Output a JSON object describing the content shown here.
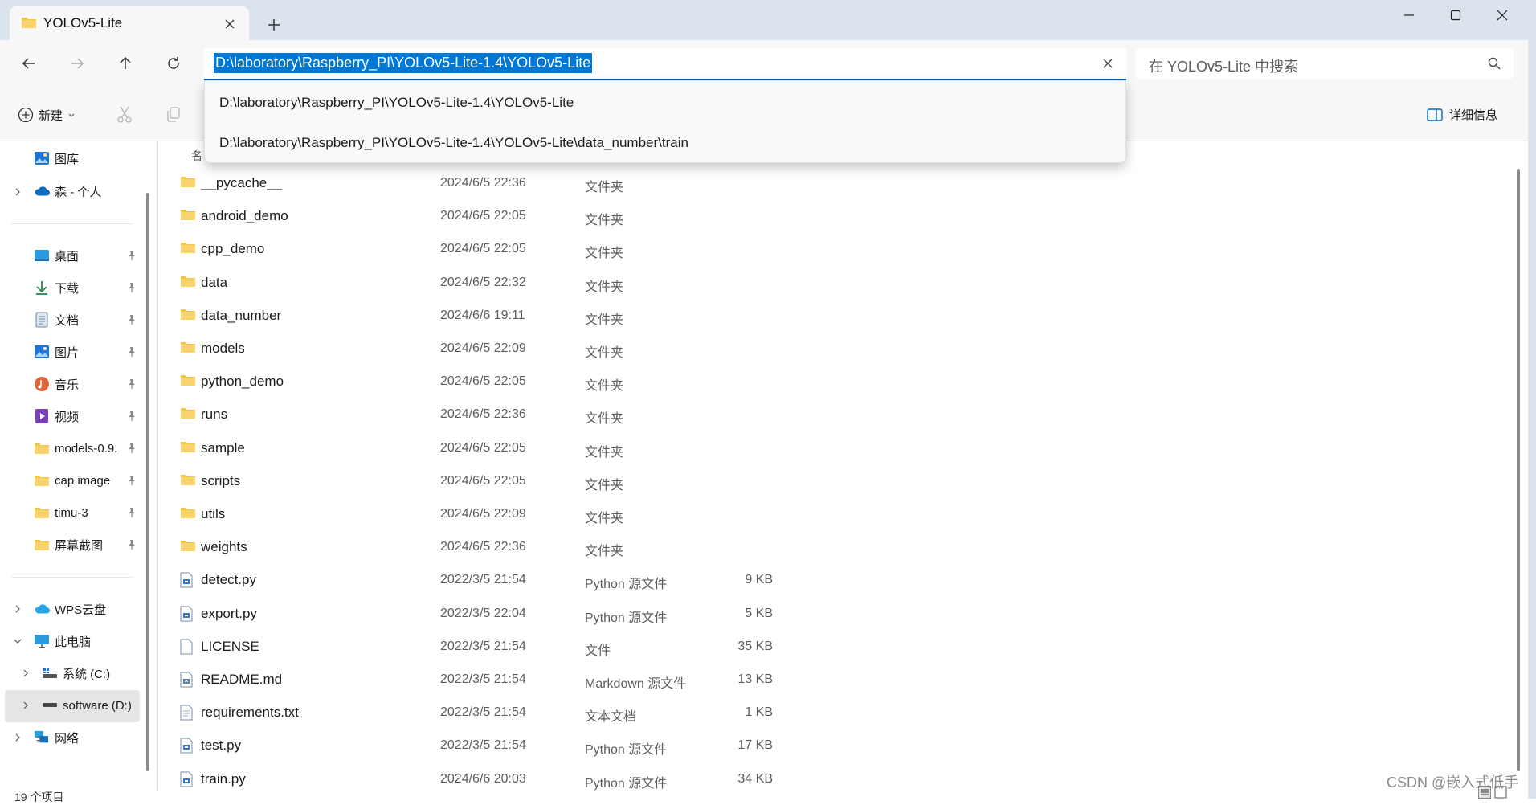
{
  "window": {
    "tab_title": "YOLOv5-Lite",
    "new_tab_label": "+",
    "controls": {
      "minimize": "minimize-icon",
      "maximize": "maximize-icon",
      "close": "close-icon"
    }
  },
  "nav": {
    "address_value": "D:\\laboratory\\Raspberry_PI\\YOLOv5-Lite-1.4\\YOLOv5-Lite",
    "search_placeholder": "在 YOLOv5-Lite 中搜索",
    "suggestions": [
      "D:\\laboratory\\Raspberry_PI\\YOLOv5-Lite-1.4\\YOLOv5-Lite",
      "D:\\laboratory\\Raspberry_PI\\YOLOv5-Lite-1.4\\YOLOv5-Lite\\data_number\\train"
    ]
  },
  "commandbar": {
    "new_label": "新建",
    "details_label": "详细信息"
  },
  "sidebar": {
    "gallery": "图库",
    "onedrive": "森 - 个人",
    "quick_access": [
      {
        "label": "桌面",
        "icon": "desktop-icon"
      },
      {
        "label": "下载",
        "icon": "download-icon"
      },
      {
        "label": "文档",
        "icon": "document-icon"
      },
      {
        "label": "图片",
        "icon": "pictures-icon"
      },
      {
        "label": "音乐",
        "icon": "music-icon"
      },
      {
        "label": "视频",
        "icon": "video-icon"
      },
      {
        "label": "models-0.9.",
        "icon": "folder-icon"
      },
      {
        "label": "cap image",
        "icon": "folder-icon"
      },
      {
        "label": "timu-3",
        "icon": "folder-icon"
      },
      {
        "label": "屏幕截图",
        "icon": "folder-icon"
      }
    ],
    "wps": "WPS云盘",
    "this_pc": "此电脑",
    "drive_c": "系统 (C:)",
    "drive_d": "software (D:)",
    "network": "网络",
    "status_count": "19 个项目"
  },
  "filelist": {
    "name_header": "名",
    "rows": [
      {
        "name": "__pycache__",
        "date": "2024/6/5 22:36",
        "type": "文件夹",
        "size": "",
        "kind": "folder"
      },
      {
        "name": "android_demo",
        "date": "2024/6/5 22:05",
        "type": "文件夹",
        "size": "",
        "kind": "folder"
      },
      {
        "name": "cpp_demo",
        "date": "2024/6/5 22:05",
        "type": "文件夹",
        "size": "",
        "kind": "folder"
      },
      {
        "name": "data",
        "date": "2024/6/5 22:32",
        "type": "文件夹",
        "size": "",
        "kind": "folder"
      },
      {
        "name": "data_number",
        "date": "2024/6/6 19:11",
        "type": "文件夹",
        "size": "",
        "kind": "folder"
      },
      {
        "name": "models",
        "date": "2024/6/5 22:09",
        "type": "文件夹",
        "size": "",
        "kind": "folder"
      },
      {
        "name": "python_demo",
        "date": "2024/6/5 22:05",
        "type": "文件夹",
        "size": "",
        "kind": "folder"
      },
      {
        "name": "runs",
        "date": "2024/6/5 22:36",
        "type": "文件夹",
        "size": "",
        "kind": "folder"
      },
      {
        "name": "sample",
        "date": "2024/6/5 22:05",
        "type": "文件夹",
        "size": "",
        "kind": "folder"
      },
      {
        "name": "scripts",
        "date": "2024/6/5 22:05",
        "type": "文件夹",
        "size": "",
        "kind": "folder"
      },
      {
        "name": "utils",
        "date": "2024/6/5 22:09",
        "type": "文件夹",
        "size": "",
        "kind": "folder"
      },
      {
        "name": "weights",
        "date": "2024/6/5 22:36",
        "type": "文件夹",
        "size": "",
        "kind": "folder"
      },
      {
        "name": "detect.py",
        "date": "2022/3/5 21:54",
        "type": "Python 源文件",
        "size": "9 KB",
        "kind": "python"
      },
      {
        "name": "export.py",
        "date": "2022/3/5 22:04",
        "type": "Python 源文件",
        "size": "5 KB",
        "kind": "python"
      },
      {
        "name": "LICENSE",
        "date": "2022/3/5 21:54",
        "type": "文件",
        "size": "35 KB",
        "kind": "blank"
      },
      {
        "name": "README.md",
        "date": "2022/3/5 21:54",
        "type": "Markdown 源文件",
        "size": "13 KB",
        "kind": "markdown"
      },
      {
        "name": "requirements.txt",
        "date": "2022/3/5 21:54",
        "type": "文本文档",
        "size": "1 KB",
        "kind": "text"
      },
      {
        "name": "test.py",
        "date": "2022/3/5 21:54",
        "type": "Python 源文件",
        "size": "17 KB",
        "kind": "python"
      },
      {
        "name": "train.py",
        "date": "2024/6/6 20:03",
        "type": "Python 源文件",
        "size": "34 KB",
        "kind": "python"
      }
    ]
  },
  "watermark": "CSDN @嵌入式低手",
  "colors": {
    "accent": "#0078d4",
    "folder": "#f4c443",
    "titlebar": "#dbe3ec"
  }
}
